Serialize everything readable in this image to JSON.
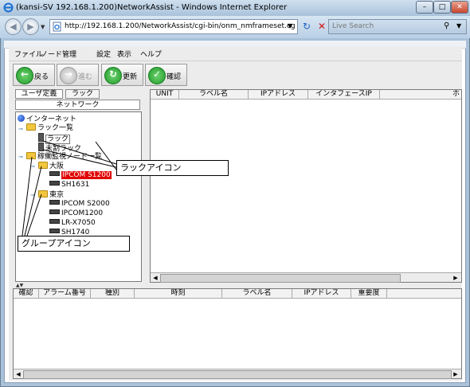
{
  "window": {
    "title": "(kansi-SV 192.168.1.200)NetworkAssist - Windows Internet Explorer",
    "min_label": "–",
    "max_label": "□",
    "close_label": "✕"
  },
  "browser": {
    "address": "http://192.168.1.200/NetworkAssist/cgi-bin/onm_nmframeset.cg",
    "search_placeholder": "Live Search"
  },
  "menu": {
    "items": [
      "ファイル",
      "ノード管理",
      "設定",
      "表示",
      "ヘルプ"
    ]
  },
  "toolbar": {
    "back": "戻る",
    "forward": "進む",
    "update": "更新",
    "confirm": "確認"
  },
  "left_panel": {
    "tabs": [
      "ユーザ定義",
      "ラック"
    ],
    "subtab": "ネットワーク",
    "tree": {
      "root": "インターネット",
      "rack_list": "ラック一覧",
      "rack": "ラック",
      "unplaced_rack": "未割ラック",
      "monitored_nodes": "稼働監視ノード一覧",
      "osaka": "大阪",
      "osaka_nodes": [
        "IPCOM S1200",
        "SH1631"
      ],
      "tokyo": "東京",
      "tokyo_nodes": [
        "IPCOM S2000",
        "IPCOM1200",
        "LR-X7050",
        "SH1740"
      ]
    }
  },
  "node_table": {
    "columns": [
      "UNIT",
      "ラベル名",
      "IPアドレス",
      "インタフェースIP",
      "ホ"
    ]
  },
  "alarm_table": {
    "columns": [
      "確認",
      "アラーム番号",
      "種別",
      "時刻",
      "ラベル名",
      "IPアドレス",
      "重要度"
    ]
  },
  "callouts": {
    "rack_icon": "ラックアイコン",
    "group_icon": "グループアイコン"
  },
  "colors": {
    "selected_node_bg": "#e00000",
    "button_green": "#1f9a2a"
  }
}
